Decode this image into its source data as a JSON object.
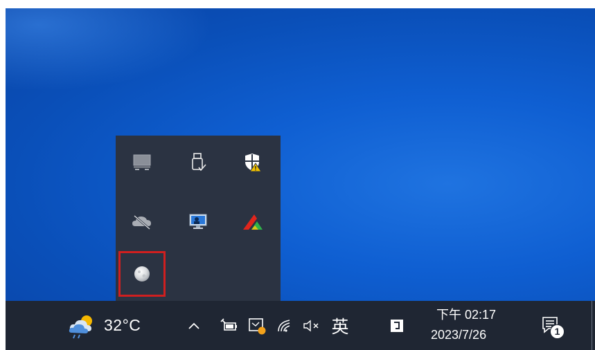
{
  "tray_overflow": {
    "icons": [
      {
        "name": "network-drive-icon",
        "row": 1,
        "col": 1
      },
      {
        "name": "usb-safely-remove-icon",
        "row": 1,
        "col": 2
      },
      {
        "name": "security-shield-warning-icon",
        "row": 1,
        "col": 3
      },
      {
        "name": "onedrive-offline-icon",
        "row": 2,
        "col": 1
      },
      {
        "name": "remote-display-icon",
        "row": 2,
        "col": 2
      },
      {
        "name": "red-green-app-icon",
        "row": 2,
        "col": 3
      },
      {
        "name": "moon-app-icon",
        "row": 3,
        "col": 1,
        "highlighted": true
      }
    ],
    "highlight_color": "#d01f1f"
  },
  "taskbar": {
    "weather": {
      "icon": "partly-cloudy-rain-icon",
      "temperature": "32°C"
    },
    "tray": {
      "show_hidden_icons": "^",
      "icons": [
        "power-battery-icon",
        "screen-snip-icon",
        "wifi-icon",
        "volume-muted-icon"
      ],
      "volume_glyph": "ᅌ×",
      "ime_label": "英",
      "ime_mode_icon": "input-mode-icon"
    },
    "clock": {
      "time": "下午 02:17",
      "date": "2023/7/26"
    },
    "notifications": {
      "icon": "action-center-icon",
      "badge_count": "1"
    }
  },
  "colors": {
    "taskbar_bg": "#1f2633",
    "flyout_bg": "#2b3342",
    "desktop_blue": "#0f5fd2"
  }
}
